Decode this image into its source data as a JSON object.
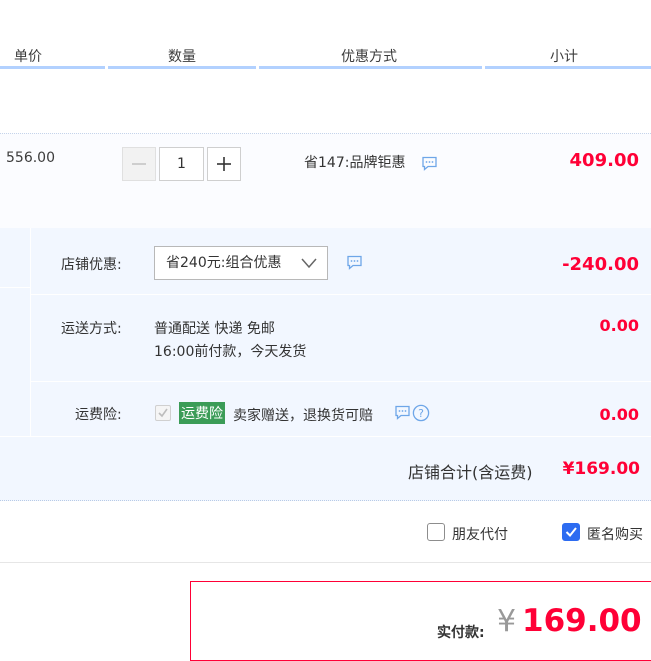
{
  "header": {
    "col_unit_price": "单价",
    "col_quantity": "数量",
    "col_discount": "优惠方式",
    "col_subtotal": "小计"
  },
  "item": {
    "unit_price": "556.00",
    "quantity": "1",
    "promo_text": "省147:品牌钜惠",
    "subtotal": "409.00"
  },
  "shop": {
    "discount_label": "店铺优惠:",
    "discount_selected": "省240元:组合优惠",
    "discount_amount": "-240.00",
    "shipping_label": "运送方式:",
    "shipping_method": "普通配送 快递 免邮",
    "shipping_note": "16:00前付款，今天发货",
    "shipping_amount": "0.00",
    "insurance_label": "运费险:",
    "insurance_tag": "运费险",
    "insurance_text": "卖家赠送，退换货可赔",
    "insurance_amount": "0.00",
    "total_label": "店铺合计(含运费)",
    "total_amount": "¥169.00"
  },
  "options": {
    "friend_pay_label": "朋友代付",
    "friend_pay_checked": false,
    "anonymous_label": "匿名购买",
    "anonymous_checked": true
  },
  "payment": {
    "label": "实付款:",
    "currency": "¥",
    "amount": "169.00"
  },
  "colors": {
    "accent_red": "#ff0036",
    "header_line": "#b2d1ff",
    "panel_bg": "#f2f7ff",
    "insurance_green": "#3b9c57",
    "checkbox_blue": "#2d6cf1"
  }
}
